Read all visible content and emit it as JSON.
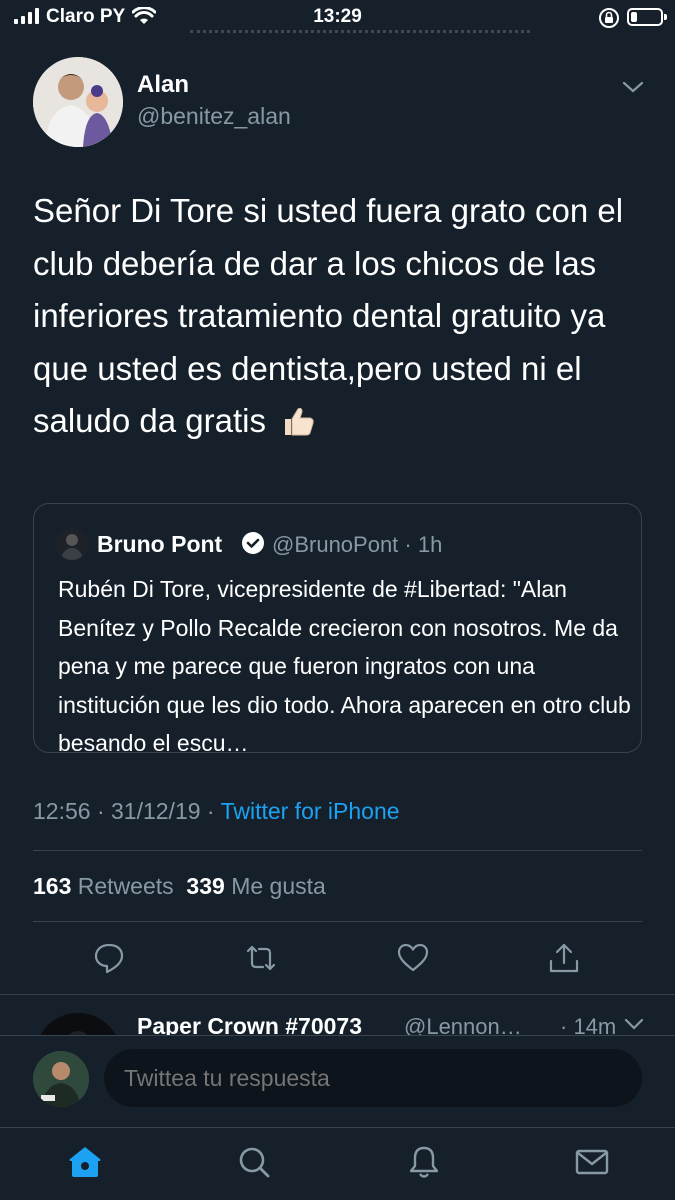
{
  "status_bar": {
    "carrier": "Claro PY",
    "time": "13:29",
    "battery_level": 0.2
  },
  "tweet": {
    "author_name": "Alan",
    "author_handle": "@benitez_alan",
    "text": "Señor Di Tore si usted fuera grato con el club debería de dar a los chicos de las inferiores tratamiento dental gratuito ya que usted es dentista,pero usted ni el saludo da gratis",
    "emoji": "thumbs-up-emoji",
    "time": "12:56 · 31/12/19 · ",
    "source": "Twitter for iPhone",
    "retweets_count": "163",
    "retweets_label": "Retweets",
    "likes_count": "339",
    "likes_label": "Me gusta"
  },
  "quote": {
    "name": "Bruno Pont",
    "handle": "@BrunoPont · 1h",
    "text": "Rubén Di Tore, vicepresidente de #Libertad: \"Alan Benítez y Pollo Recalde crecieron con nosotros. Me da pena y me parece que fueron ingratos con una institución que les dio todo. Ahora aparecen en otro club besando el escu…"
  },
  "next_tweet": {
    "name": "Paper Crown #70073",
    "handle": "@Lennon…",
    "time": "· 14m"
  },
  "reply": {
    "placeholder": "Twittea tu respuesta"
  },
  "colors": {
    "background": "#15202b",
    "accent": "#1da1f2",
    "secondary_text": "#8899a6",
    "border": "#38444d"
  }
}
